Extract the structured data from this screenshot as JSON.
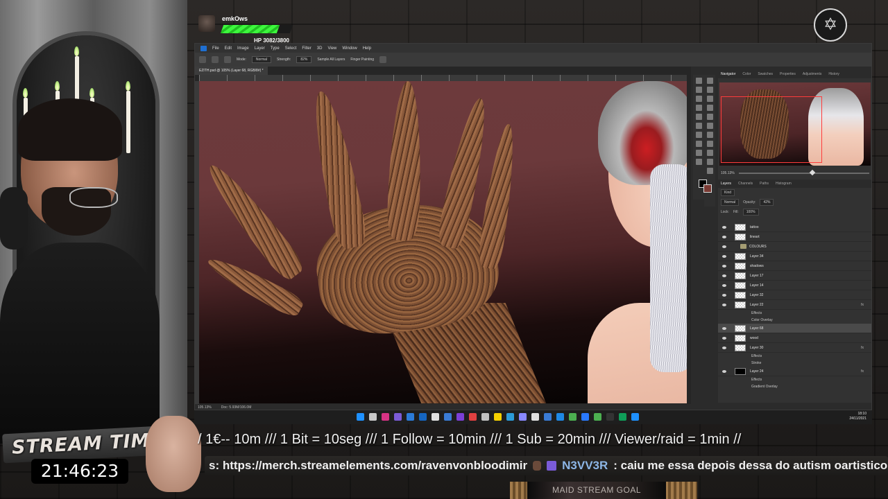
{
  "hud": {
    "username": "emkOws",
    "hp_label": "HP 3082/3800",
    "hp_fraction": 0.81
  },
  "photoshop": {
    "menu": [
      "File",
      "Edit",
      "Image",
      "Layer",
      "Type",
      "Select",
      "Filter",
      "3D",
      "View",
      "Window",
      "Help"
    ],
    "options": {
      "mode_label": "Mode:",
      "mode_value": "Normal",
      "strength_label": "Strength:",
      "strength_value": "82%",
      "sample_all_layers": "Sample All Layers",
      "finger_painting": "Finger Painting"
    },
    "doc_tab": "EZITH.psd @ 105% (Layer 68, RGB/8#) *",
    "status_zoom": "105.13%",
    "status_doc": "Doc: 5.93M/106.0M",
    "top_panel_tabs": [
      "Navigator",
      "Color",
      "Swatches",
      "Properties",
      "Adjustments",
      "History"
    ],
    "navigator_zoom": "105.13%",
    "navigator_zoom_fraction": 0.55,
    "layer_panel_tabs": [
      "Layers",
      "Channels",
      "Paths",
      "Histogram"
    ],
    "filter_kind": "Kind",
    "blend_mode": "Normal",
    "opacity_label": "Opacity:",
    "opacity_value": "42%",
    "lock_label": "Lock:",
    "fill_label": "Fill:",
    "fill_value": "100%",
    "layers": [
      {
        "name": "tattoo",
        "kind": "layer"
      },
      {
        "name": "lineart",
        "kind": "layer"
      },
      {
        "name": "COLOURS",
        "kind": "folder"
      },
      {
        "name": "Layer 34",
        "kind": "layer"
      },
      {
        "name": "shadows",
        "kind": "layer"
      },
      {
        "name": "Layer 17",
        "kind": "layer"
      },
      {
        "name": "Layer 14",
        "kind": "layer"
      },
      {
        "name": "Layer 32",
        "kind": "layer"
      },
      {
        "name": "Layer 22",
        "kind": "layer",
        "fx": "fx"
      },
      {
        "name": "Effects",
        "kind": "sub"
      },
      {
        "name": "Color Overlay",
        "kind": "sub"
      },
      {
        "name": "Layer 68",
        "kind": "layer",
        "selected": true
      },
      {
        "name": "wood",
        "kind": "layer"
      },
      {
        "name": "Layer 30",
        "kind": "layer",
        "fx": "fx"
      },
      {
        "name": "Effects",
        "kind": "sub"
      },
      {
        "name": "Stroke",
        "kind": "sub"
      },
      {
        "name": "Layer 24",
        "kind": "layer",
        "fx": "fx",
        "thumb": "black"
      },
      {
        "name": "Effects",
        "kind": "sub"
      },
      {
        "name": "Gradient Overlay",
        "kind": "sub"
      }
    ]
  },
  "taskbar": {
    "time": "18:10",
    "date": "24/11/2021",
    "icon_colors": [
      "#1e90ff",
      "#c8c8c8",
      "#d63384",
      "#7b5bd6",
      "#2b7bd8",
      "#1565c0",
      "#e0e0e0",
      "#3a7bd5",
      "#7b3fd6",
      "#e04040",
      "#c0c0c0",
      "#f5d000",
      "#2b9bd8",
      "#8888ff",
      "#e0e0e0",
      "#3a7bd5",
      "#1e88e5",
      "#4caf50",
      "#2979ff",
      "#4caf50",
      "#333",
      "#0f9d58",
      "#1e90ff"
    ]
  },
  "stream": {
    "time_label": "STREAM TIME",
    "time_value": "21:46:23",
    "ticker_main": "/  1€-- 10m /// 1 Bit = 10seg  /// 1 Follow = 10min /// 1 Sub = 20min /// Viewer/raid = 1min //",
    "ticker_chat_prefix": "s: https://merch.streamelements.com/ravenvonbloodimir",
    "ticker_chat_user": "N3VV3R",
    "ticker_chat_message": ": caiu me essa  depois dessa do autism oartistico",
    "goal_label": "MAID STREAM GOAL"
  },
  "colors": {
    "hp_bar": "#3df83d",
    "ps_bg": "#2b2b2b",
    "nav_rect": "#ff3b3b"
  }
}
